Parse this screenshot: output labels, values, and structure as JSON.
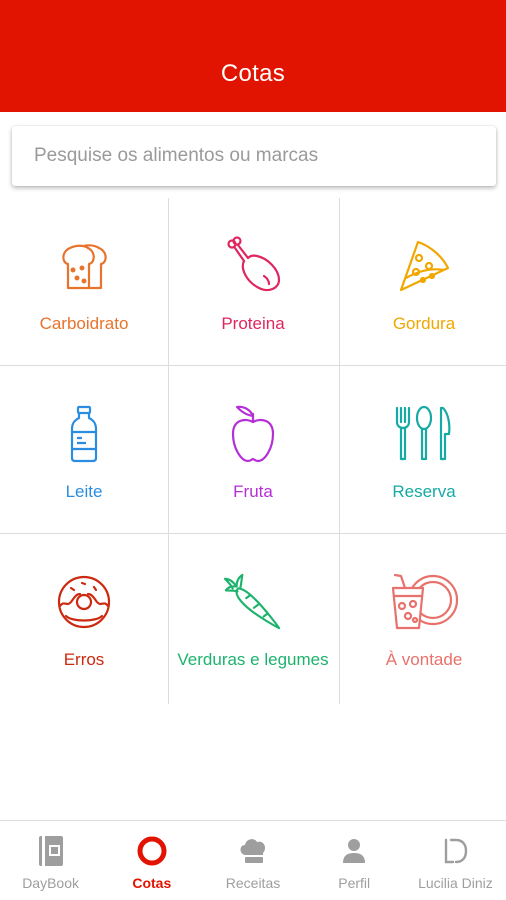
{
  "header": {
    "title": "Cotas"
  },
  "search": {
    "placeholder": "Pesquise os alimentos ou marcas"
  },
  "categories": [
    {
      "label": "Carboidrato",
      "icon": "bread-icon",
      "color": "#e8732c"
    },
    {
      "label": "Proteina",
      "icon": "chicken-leg-icon",
      "color": "#e0255f"
    },
    {
      "label": "Gordura",
      "icon": "pizza-slice-icon",
      "color": "#f0a800"
    },
    {
      "label": "Leite",
      "icon": "milk-bottle-icon",
      "color": "#2b8de0"
    },
    {
      "label": "Fruta",
      "icon": "apple-icon",
      "color": "#b42fd6"
    },
    {
      "label": "Reserva",
      "icon": "cutlery-icon",
      "color": "#16aaa4"
    },
    {
      "label": "Erros",
      "icon": "donut-icon",
      "color": "#cc2a10"
    },
    {
      "label": "Verduras e legumes",
      "icon": "carrot-icon",
      "color": "#1eb36d"
    },
    {
      "label": "À vontade",
      "icon": "drink-and-plate-icon",
      "color": "#e8716b"
    }
  ],
  "nav": {
    "items": [
      {
        "label": "DayBook",
        "icon": "book-icon"
      },
      {
        "label": "Cotas",
        "icon": "ring-icon",
        "active": true
      },
      {
        "label": "Receitas",
        "icon": "chef-hat-icon"
      },
      {
        "label": "Perfil",
        "icon": "person-icon"
      },
      {
        "label": "Lucilia Diniz",
        "icon": "ld-logo-icon"
      }
    ],
    "active_color": "#e01400",
    "inactive_color": "#9e9e9e"
  }
}
